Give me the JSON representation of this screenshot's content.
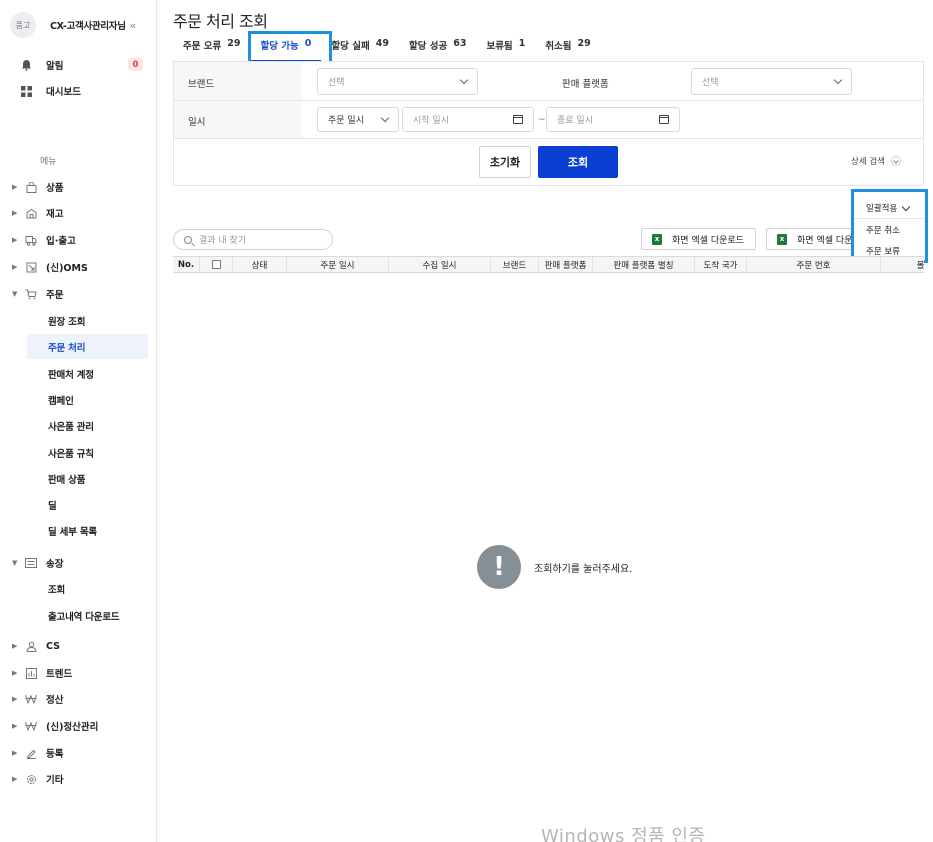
{
  "sidebar": {
    "logo_text": "품고",
    "user_name": "CX-고객사관리자님",
    "collapse_glyph": "«",
    "top_items": [
      {
        "label": "알림",
        "badge": "0"
      },
      {
        "label": "대시보드"
      }
    ],
    "menu_heading": "메뉴",
    "nav": {
      "product": "상품",
      "stock": "재고",
      "inout": "입·출고",
      "oms": "(신)OMS",
      "order": "주문",
      "order_subs": [
        "원장 조회",
        "주문 처리",
        "판매처 계정",
        "캠페인",
        "사은품 관리",
        "사은품 규칙",
        "판매 상품",
        "딜",
        "딜 세부 목록"
      ],
      "waybill": "송장",
      "waybill_subs": [
        "조회",
        "출고내역 다운로드"
      ],
      "cs": "CS",
      "trend": "트렌드",
      "settle": "정산",
      "settle_new": "(신)정산관리",
      "register": "등록",
      "etc": "기타"
    }
  },
  "page_title": "주문 처리 조회",
  "tabs": [
    {
      "label": "주문 오류",
      "count": "29"
    },
    {
      "label": "할당 가능",
      "count": "0"
    },
    {
      "label": "할당 실패",
      "count": "49"
    },
    {
      "label": "할당 성공",
      "count": "63"
    },
    {
      "label": "보류됨",
      "count": "1"
    },
    {
      "label": "취소됨",
      "count": "29"
    }
  ],
  "filter": {
    "brand_label": "브랜드",
    "brand_placeholder": "선택",
    "platform_label": "판매 플랫폼",
    "platform_placeholder": "선택",
    "date_label": "일시",
    "date_type": "주문 일시",
    "start_placeholder": "시작 일시",
    "tilde": "~",
    "end_placeholder": "종료 일시",
    "reset": "초기화",
    "search": "조회",
    "detail_search": "상세 검색"
  },
  "bulk": {
    "label": "일괄적용",
    "options": [
      "주문 취소",
      "주문 보류"
    ]
  },
  "result_search_placeholder": "결과 내 찾기",
  "excel_buttons": [
    "화면 엑셀 다운로드",
    "화면 엑셀 다운로드"
  ],
  "table_headers": [
    "No.",
    "상태",
    "주문 일시",
    "수집 일시",
    "브랜드",
    "판매 플랫폼",
    "판매 플랫폼 별칭",
    "도착 국가",
    "주문 번호",
    "몰 번"
  ],
  "empty_message": "조회하기를 눌러주세요.",
  "watermark": "Windows 정품 인증"
}
